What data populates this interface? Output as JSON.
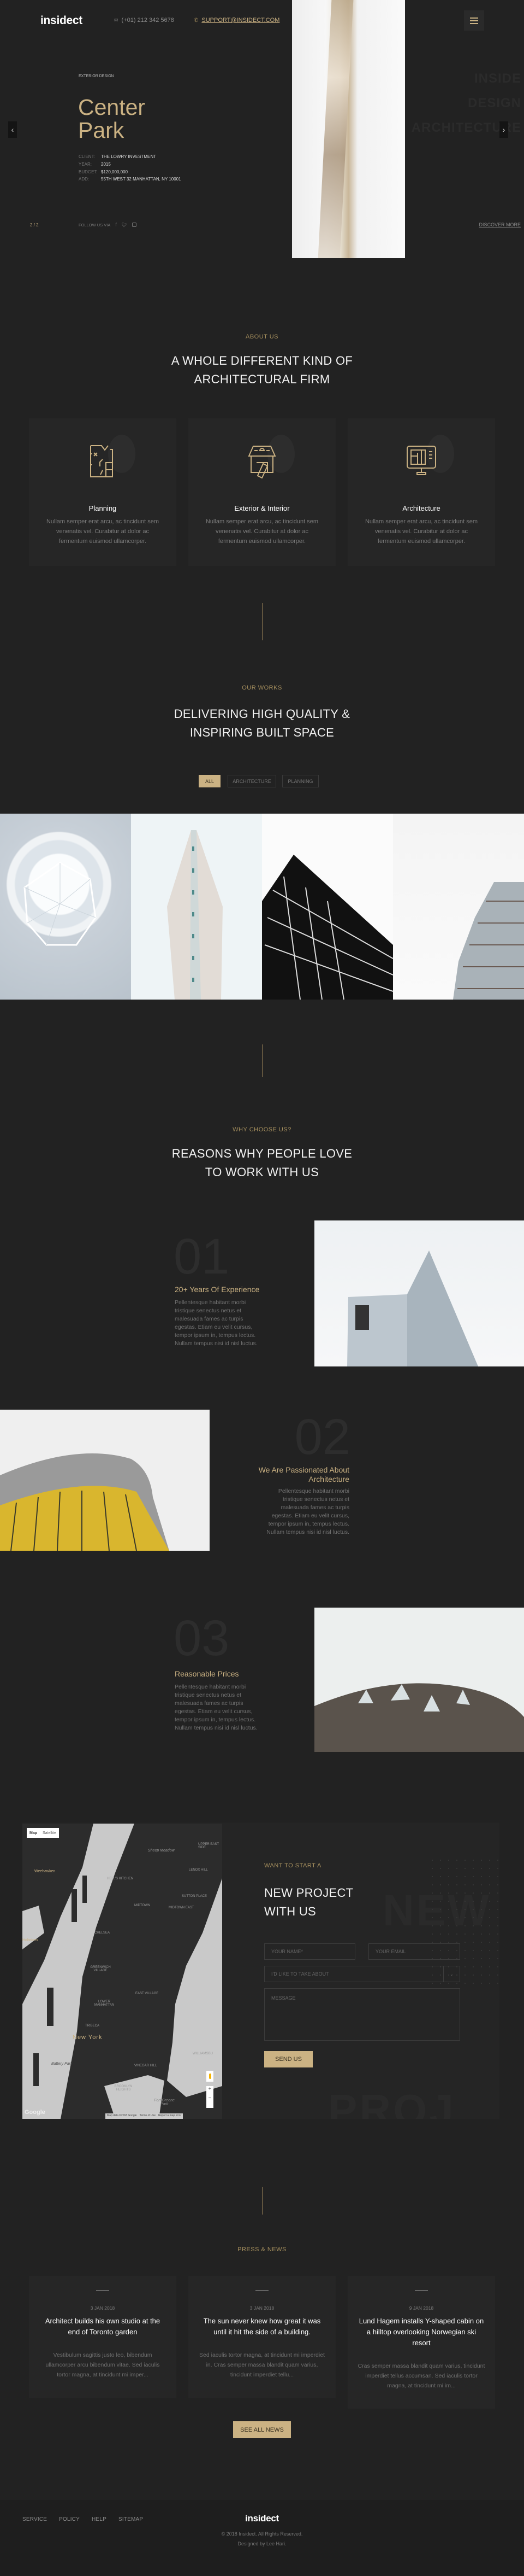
{
  "header": {
    "logo": "insidect",
    "phone": "(+01) 212 342 5678",
    "email": "SUPPORT@INSIDECT.COM",
    "menu_icon": "hamburger-icon"
  },
  "hero": {
    "category": "EXTERIOR DESIGN",
    "title_line1": "Center",
    "title_line2": "Park",
    "details": [
      {
        "key": "CLIENT:",
        "value": "THE LOWRY INVESTMENT"
      },
      {
        "key": "YEAR:",
        "value": "2015"
      },
      {
        "key": "BUDGET:",
        "value": "$120,000,000"
      },
      {
        "key": "ADD:",
        "value": "55TH WEST 32 MANHATTAN, NY 10001"
      }
    ],
    "slide_counter": "2 / 2",
    "follow_label": "FOLLOW US VIA",
    "social_icons": [
      "facebook-icon",
      "twitter-icon",
      "instagram-icon"
    ],
    "watermark_lines": [
      "INSIDE",
      "DESIGN",
      "ARCHITECTURE"
    ],
    "discover": "DISCOVER MORE"
  },
  "about": {
    "label": "ABOUT US",
    "heading_line1": "A WHOLE DIFFERENT KIND OF",
    "heading_line2": "ARCHITECTURAL FIRM",
    "cards": [
      {
        "title": "Planning",
        "desc": "Nullam semper erat arcu, ac tincidunt sem venenatis vel. Curabitur at dolor ac fermentum euismod ullamcorper.",
        "icon": "floor-plan-icon"
      },
      {
        "title": "Exterior & Interior",
        "desc": "Nullam semper erat arcu, ac tincidunt sem venenatis vel. Curabitur at dolor ac fermentum euismod ullamcorper.",
        "icon": "house-icon"
      },
      {
        "title": "Architecture",
        "desc": "Nullam semper erat arcu, ac tincidunt sem venenatis vel. Curabitur at dolor ac fermentum euismod ullamcorper.",
        "icon": "monitor-blueprint-icon"
      }
    ]
  },
  "works": {
    "label": "OUR WORKS",
    "heading_line1": "DELIVERING HIGH QUALITY &",
    "heading_line2": "INSPIRING BUILT SPACE",
    "filters": [
      "ALL",
      "ARCHITECTURE",
      "PLANNING"
    ],
    "active_filter": "ALL"
  },
  "reasons": {
    "label": "WHY CHOOSE US?",
    "heading_line1": "REASONS WHY PEOPLE LOVE",
    "heading_line2": "TO WORK WITH US",
    "items": [
      {
        "num": "01",
        "title": "20+ Years Of Experience",
        "desc": "Pellentesque habitant morbi tristique senectus netus et malesuada fames ac turpis egestas. Etiam eu velit cursus, tempor ipsum in, tempus lectus. Nullam tempus nisi id nisl luctus."
      },
      {
        "num": "02",
        "title": "We Are Passionated About Architecture",
        "desc": "Pellentesque habitant morbi tristique senectus netus et malesuada fames ac turpis egestas. Etiam eu velit cursus, tempor ipsum in, tempus lectus. Nullam tempus nisi id nisl luctus."
      },
      {
        "num": "03",
        "title": "Reasonable Prices",
        "desc": "Pellentesque habitant morbi tristique senectus netus et malesuada fames ac turpis egestas. Etiam eu velit cursus, tempor ipsum in, tempus lectus. Nullam tempus nisi id nisl luctus."
      }
    ]
  },
  "map": {
    "type_map": "Map",
    "type_satellite": "Satellite",
    "city_label": "New York",
    "labels": [
      "Weehawken",
      "Hoboken",
      "HELL'S KITCHEN",
      "MIDTOWN",
      "CHELSEA",
      "GREENWICH VILLAGE",
      "EAST VILLAGE",
      "LOWER MANHATTAN",
      "TRIBECA",
      "UPPER EAST SIDE",
      "LENOX HILL",
      "Sheep Meadow",
      "SUTTON PLACE",
      "MIDTOWN EAST",
      "WILLIAMSBU",
      "VINEGAR HILL",
      "BROOKLYN HEIGHTS",
      "Battery Park",
      "Fort Greene Park"
    ],
    "google": "Google",
    "attribution": "Map data ©2018 Google",
    "terms": "Terms of Use",
    "report": "Report a map error",
    "zoom_in": "+",
    "zoom_out": "−"
  },
  "contact": {
    "label": "WANT TO START A",
    "heading_line1": "NEW PROJECT",
    "heading_line2": "WITH US",
    "name_placeholder": "YOUR NAME*",
    "email_placeholder": "YOUR EMAIL",
    "topic_placeholder": "I'D LIKE TO TAKE ABOUT",
    "message_placeholder": "MESSAGE",
    "submit": "SEND US",
    "watermark_top": "NEW",
    "watermark_bottom": "PROJ"
  },
  "news": {
    "label": "PRESS & NEWS",
    "items": [
      {
        "date": "3 JAN 2018",
        "title": "Architect builds his own studio at the end of Toronto garden",
        "desc": "Vestibulum sagittis justo leo, bibendum ullamcorper arcu bibendum vitae. Sed iaculis tortor magna, at tincidunt mi imper..."
      },
      {
        "date": "3 JAN 2018",
        "title": "The sun never knew how great it was until it hit the side of a building.",
        "desc": "Sed iaculis tortor magna, at tincidunt mi imperdiet in. Cras semper massa blandit quam varius, tincidunt imperdiet tellu..."
      },
      {
        "date": "9 JAN 2018",
        "title": "Lund Hagem installs Y-shaped cabin on a hilltop overlooking Norwegian ski resort",
        "desc": "Cras semper massa blandit quam varius, tincidunt imperdiet tellus accumsan. Sed iaculis tortor magna, at tincidunt mi im..."
      }
    ],
    "see_all": "SEE ALL NEWS"
  },
  "footer": {
    "links": [
      "SERVICE",
      "POLICY",
      "HELP",
      "SITEMAP"
    ],
    "logo": "insidect",
    "copyright": "© 2018 Insidect. All Rights Reserved.",
    "credit": "Designed by Lee Hari."
  },
  "colors": {
    "background": "#222222",
    "accent": "#cbb283",
    "card": "#262626",
    "footer": "#1e1e1e"
  }
}
